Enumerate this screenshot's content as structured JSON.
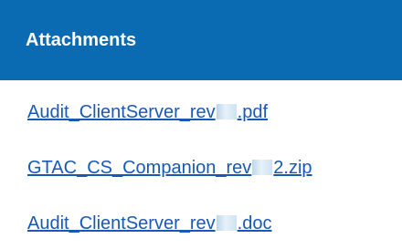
{
  "panel": {
    "title": "Attachments",
    "header_color": "#0a6ab2",
    "link_color": "#1a58b5"
  },
  "attachments": [
    {
      "prefix": "Audit_ClientServer_rev",
      "suffix": ".pdf"
    },
    {
      "prefix": "GTAC_CS_Companion_rev",
      "suffix": "2.zip"
    },
    {
      "prefix": "Audit_ClientServer_rev",
      "suffix": ".doc"
    }
  ]
}
